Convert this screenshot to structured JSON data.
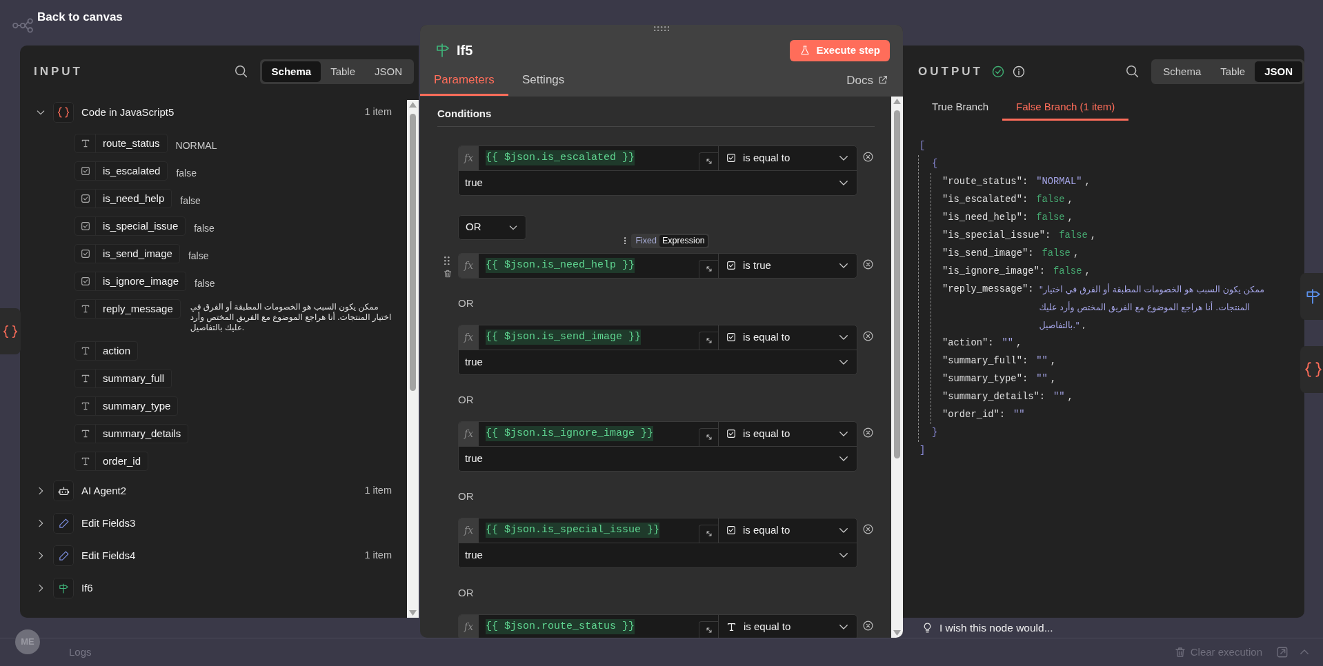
{
  "top_bar": {
    "back_label": "Back to canvas"
  },
  "input_panel": {
    "title": "INPUT",
    "view_options": [
      {
        "label": "Schema",
        "selected": true
      },
      {
        "label": "Table",
        "selected": false
      },
      {
        "label": "JSON",
        "selected": false
      }
    ],
    "nodes": [
      {
        "name": "Code in JavaScript5",
        "kind": "code",
        "expanded": true,
        "count": "1 item",
        "fields": [
          {
            "name": "route_status",
            "kind": "string",
            "value": "NORMAL"
          },
          {
            "name": "is_escalated",
            "kind": "boolean",
            "value": "false"
          },
          {
            "name": "is_need_help",
            "kind": "boolean",
            "value": "false"
          },
          {
            "name": "is_special_issue",
            "kind": "boolean",
            "value": "false"
          },
          {
            "name": "is_send_image",
            "kind": "boolean",
            "value": "false"
          },
          {
            "name": "is_ignore_image",
            "kind": "boolean",
            "value": "false"
          },
          {
            "name": "reply_message",
            "kind": "string",
            "value": "ممكن يكون السبب هو الخصومات المطبقة أو الفرق في اختيار المنتجات. أنا هراجع الموضوع مع الفريق المختص وأرد عليك بالتفاصيل."
          },
          {
            "name": "action",
            "kind": "string"
          },
          {
            "name": "summary_full",
            "kind": "string"
          },
          {
            "name": "summary_type",
            "kind": "string"
          },
          {
            "name": "summary_details",
            "kind": "string"
          },
          {
            "name": "order_id",
            "kind": "string"
          }
        ]
      },
      {
        "name": "AI Agent2",
        "kind": "agent",
        "expanded": false,
        "count": "1 item"
      },
      {
        "name": "Edit Fields3",
        "kind": "edit",
        "expanded": false
      },
      {
        "name": "Edit Fields4",
        "kind": "edit",
        "expanded": false,
        "count": "1 item"
      },
      {
        "name": "If6",
        "kind": "if",
        "expanded": false
      }
    ]
  },
  "node_panel": {
    "title": "If5",
    "execute_label": "Execute step",
    "tabs": [
      {
        "label": "Parameters",
        "selected": true
      },
      {
        "label": "Settings",
        "selected": false
      }
    ],
    "docs_label": "Docs",
    "section_title": "Conditions",
    "conditions": [
      {
        "badge": "fx",
        "expression": "{{ $json.is_escalated }}",
        "kind": "boolean",
        "operator": "is equal to",
        "value": "true"
      },
      {
        "combinator": {
          "kind": "select",
          "label": "OR"
        },
        "hovered": true,
        "mode_options": [
          {
            "label": "Fixed",
            "selected": false
          },
          {
            "label": "Expression",
            "selected": true
          }
        ],
        "badge": "fx",
        "expression": "{{ $json.is_need_help }}",
        "kind": "boolean",
        "operator": "is true"
      },
      {
        "combinator": {
          "kind": "text",
          "label": "OR"
        },
        "badge": "fx",
        "expression": "{{ $json.is_send_image }}",
        "kind": "boolean",
        "operator": "is equal to",
        "value": "true"
      },
      {
        "combinator": {
          "kind": "text",
          "label": "OR"
        },
        "badge": "fx",
        "expression": "{{ $json.is_ignore_image }}",
        "kind": "boolean",
        "operator": "is equal to",
        "value": "true"
      },
      {
        "combinator": {
          "kind": "text",
          "label": "OR"
        },
        "badge": "fx",
        "expression": "{{ $json.is_special_issue }}",
        "kind": "boolean",
        "operator": "is equal to",
        "value": "true"
      },
      {
        "combinator": {
          "kind": "text",
          "label": "OR"
        },
        "badge": "fx",
        "expression": "{{ $json.route_status }}",
        "kind": "string",
        "operator": "is equal to"
      }
    ]
  },
  "output_panel": {
    "title": "OUTPUT",
    "view_options": [
      {
        "label": "Schema",
        "selected": false
      },
      {
        "label": "Table",
        "selected": false
      },
      {
        "label": "JSON",
        "selected": true
      }
    ],
    "branches": [
      {
        "label": "True Branch",
        "selected": false
      },
      {
        "label": "False Branch (1 item)",
        "selected": true
      }
    ],
    "json": {
      "open_outer": "[",
      "open_inner": "{",
      "fields": [
        {
          "key": "\"route_status\":",
          "value": "\"NORMAL\"",
          "kind": "string",
          "sep": ","
        },
        {
          "key": "\"is_escalated\":",
          "value": "false",
          "kind": "boolean",
          "sep": ","
        },
        {
          "key": "\"is_need_help\":",
          "value": "false",
          "kind": "boolean",
          "sep": ","
        },
        {
          "key": "\"is_special_issue\":",
          "value": "false",
          "kind": "boolean",
          "sep": ","
        },
        {
          "key": "\"is_send_image\":",
          "value": "false",
          "kind": "boolean",
          "sep": ","
        },
        {
          "key": "\"is_ignore_image\":",
          "value": "false",
          "kind": "boolean",
          "sep": ","
        },
        {
          "key": "\"reply_message\":",
          "value": "\"ممكن يكون السبب هو الخصومات المطبقة أو الفرق في اختيار المنتجات. أنا هراجع الموضوع مع الفريق المختص وأرد عليك بالتفاصيل.\"",
          "kind": "string",
          "sep": ","
        },
        {
          "key": "\"action\":",
          "value": "\"\"",
          "kind": "string",
          "sep": ","
        },
        {
          "key": "\"summary_full\":",
          "value": "\"\"",
          "kind": "string",
          "sep": ","
        },
        {
          "key": "\"summary_type\":",
          "value": "\"\"",
          "kind": "string",
          "sep": ","
        },
        {
          "key": "\"summary_details\":",
          "value": "\"\"",
          "kind": "string",
          "sep": ","
        },
        {
          "key": "\"order_id\":",
          "value": "\"\"",
          "kind": "string"
        }
      ],
      "close_inner": "}",
      "close_outer": "]"
    }
  },
  "feedback": {
    "label": "I wish this node would..."
  },
  "logs_bar": {
    "title": "Logs",
    "clear_label": "Clear execution"
  },
  "user": {
    "initials": "ME"
  }
}
